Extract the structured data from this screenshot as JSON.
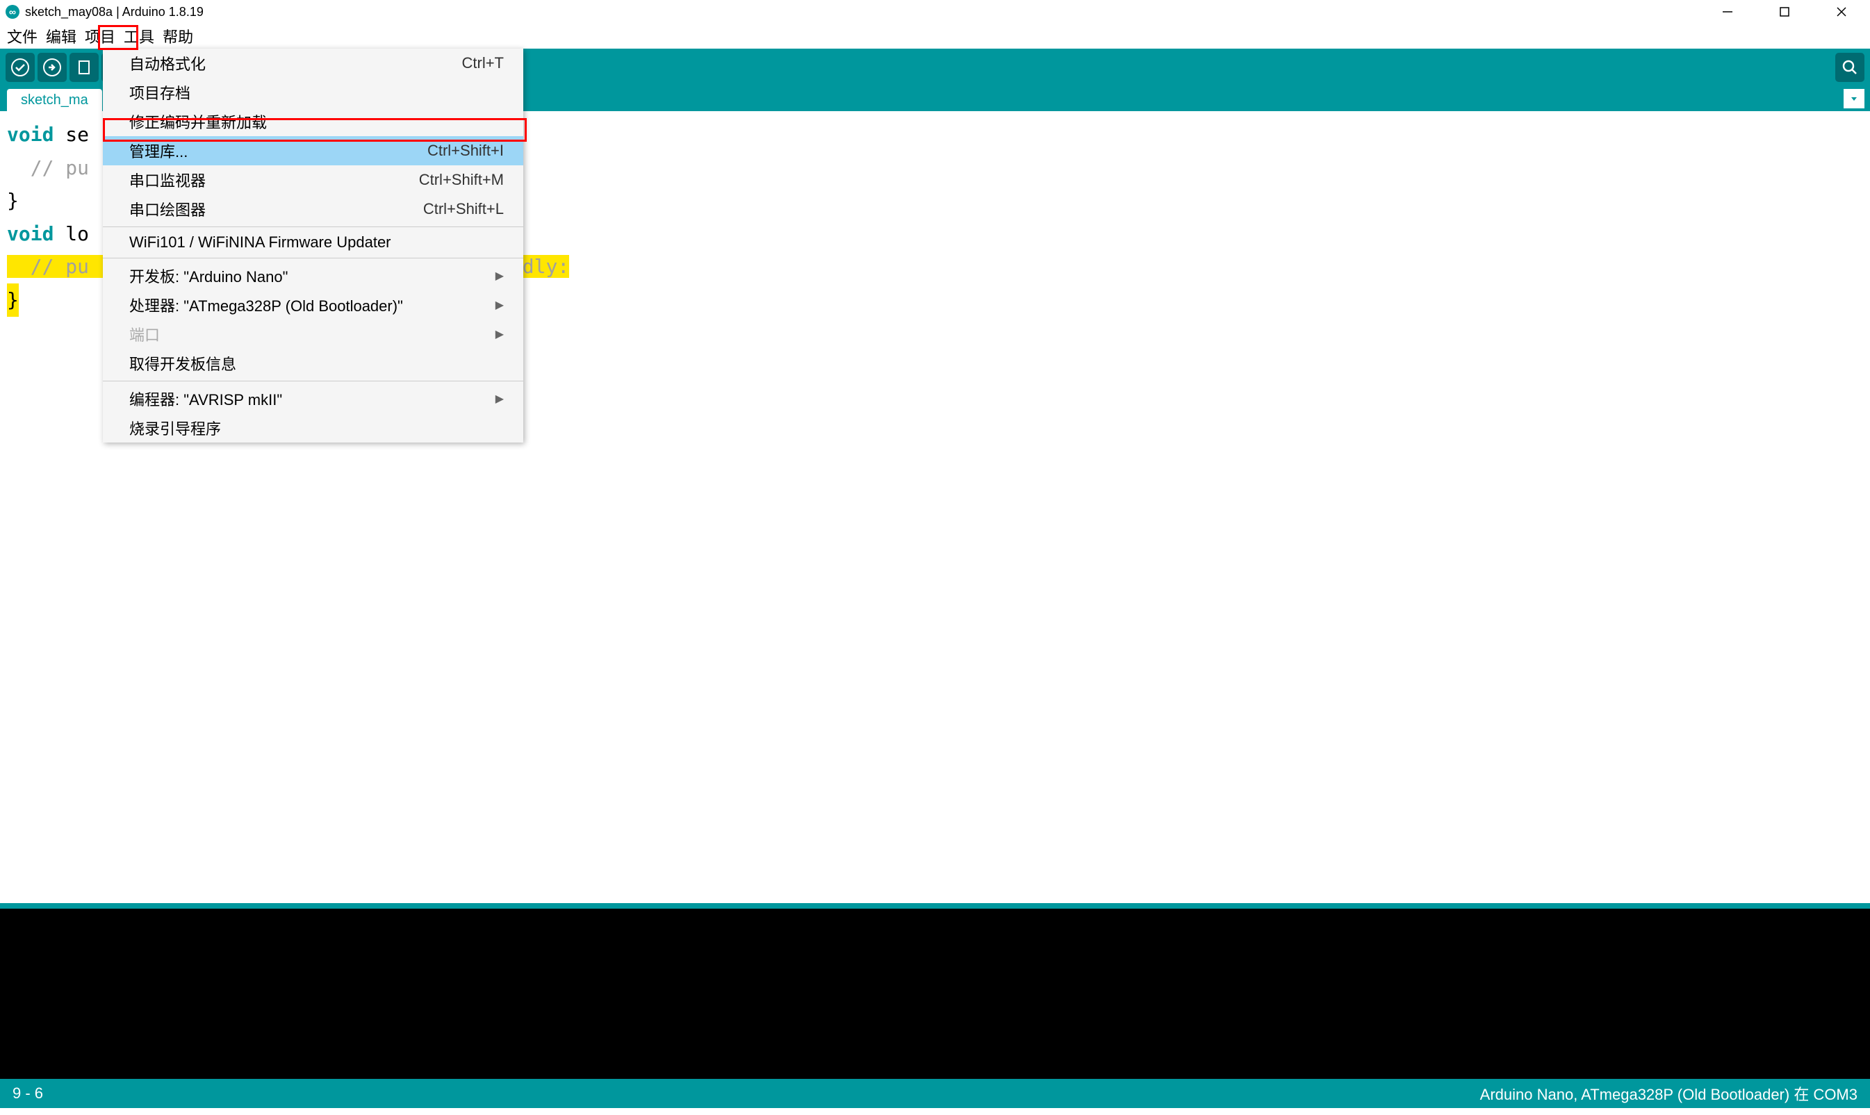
{
  "window": {
    "title": "sketch_may08a | Arduino 1.8.19"
  },
  "menubar": {
    "items": [
      "文件",
      "编辑",
      "项目",
      "工具",
      "帮助"
    ]
  },
  "toolbar": {
    "verify": "verify",
    "upload": "upload",
    "new": "new",
    "open": "open",
    "save": "save",
    "serial_monitor": "serial-monitor"
  },
  "tab": {
    "name": "sketch_ma"
  },
  "menu": {
    "items": [
      {
        "label": "自动格式化",
        "shortcut": "Ctrl+T",
        "type": "item"
      },
      {
        "label": "项目存档",
        "shortcut": "",
        "type": "item"
      },
      {
        "label": "修正编码并重新加载",
        "shortcut": "",
        "type": "item"
      },
      {
        "label": "管理库...",
        "shortcut": "Ctrl+Shift+I",
        "type": "item",
        "selected": true
      },
      {
        "label": "串口监视器",
        "shortcut": "Ctrl+Shift+M",
        "type": "item"
      },
      {
        "label": "串口绘图器",
        "shortcut": "Ctrl+Shift+L",
        "type": "item"
      },
      {
        "type": "separator"
      },
      {
        "label": "WiFi101 / WiFiNINA Firmware Updater",
        "shortcut": "",
        "type": "item"
      },
      {
        "type": "separator"
      },
      {
        "label": "开发板: \"Arduino Nano\"",
        "shortcut": "",
        "type": "submenu"
      },
      {
        "label": "处理器: \"ATmega328P (Old Bootloader)\"",
        "shortcut": "",
        "type": "submenu"
      },
      {
        "label": "端口",
        "shortcut": "",
        "type": "submenu",
        "disabled": true
      },
      {
        "label": "取得开发板信息",
        "shortcut": "",
        "type": "item"
      },
      {
        "type": "separator"
      },
      {
        "label": "编程器: \"AVRISP mkII\"",
        "shortcut": "",
        "type": "submenu"
      },
      {
        "label": "烧录引导程序",
        "shortcut": "",
        "type": "item"
      }
    ]
  },
  "editor": {
    "line1_kw": "void",
    "line1_rest": " se",
    "line2": "  // pu                            run once:",
    "line3": "",
    "line4": "}",
    "line5": "",
    "line6_kw": "void",
    "line6_rest": " lo",
    "line7_pre": "  // pu                           ",
    "line7_hl": "un repeatedly:",
    "line8": "",
    "line9": "}"
  },
  "status": {
    "left": "9 - 6",
    "right": "Arduino Nano, ATmega328P (Old Bootloader) 在 COM3"
  }
}
